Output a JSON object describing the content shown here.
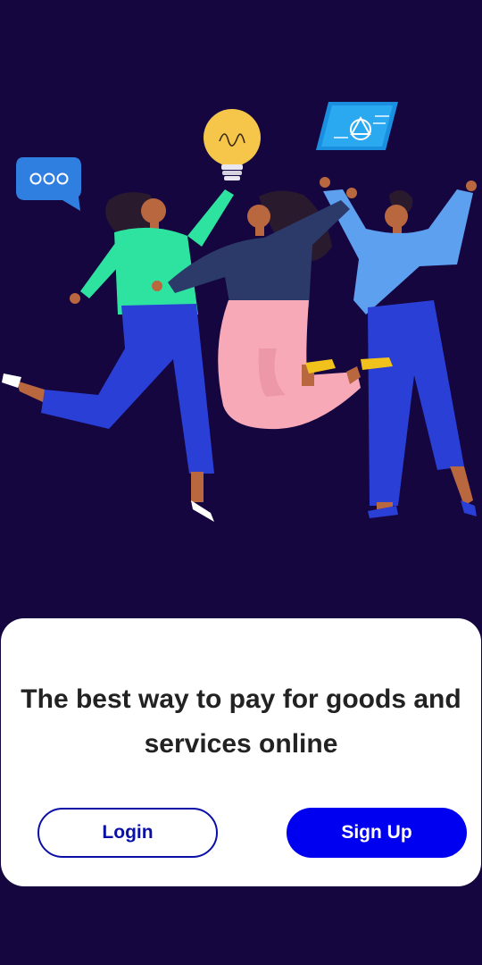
{
  "welcome": {
    "headline": "The best way to pay for goods and services online"
  },
  "actions": {
    "login_label": "Login",
    "signup_label": "Sign Up"
  },
  "illustration": {
    "description_icon": "people-celebrating-illustration",
    "icons": [
      "chat-bubble-icon",
      "lightbulb-icon",
      "screen-card-icon"
    ]
  },
  "colors": {
    "background": "#150640",
    "card": "#ffffff",
    "primary": "#0000f0",
    "login_outline": "#0a10a6",
    "headline_text": "#222222"
  }
}
